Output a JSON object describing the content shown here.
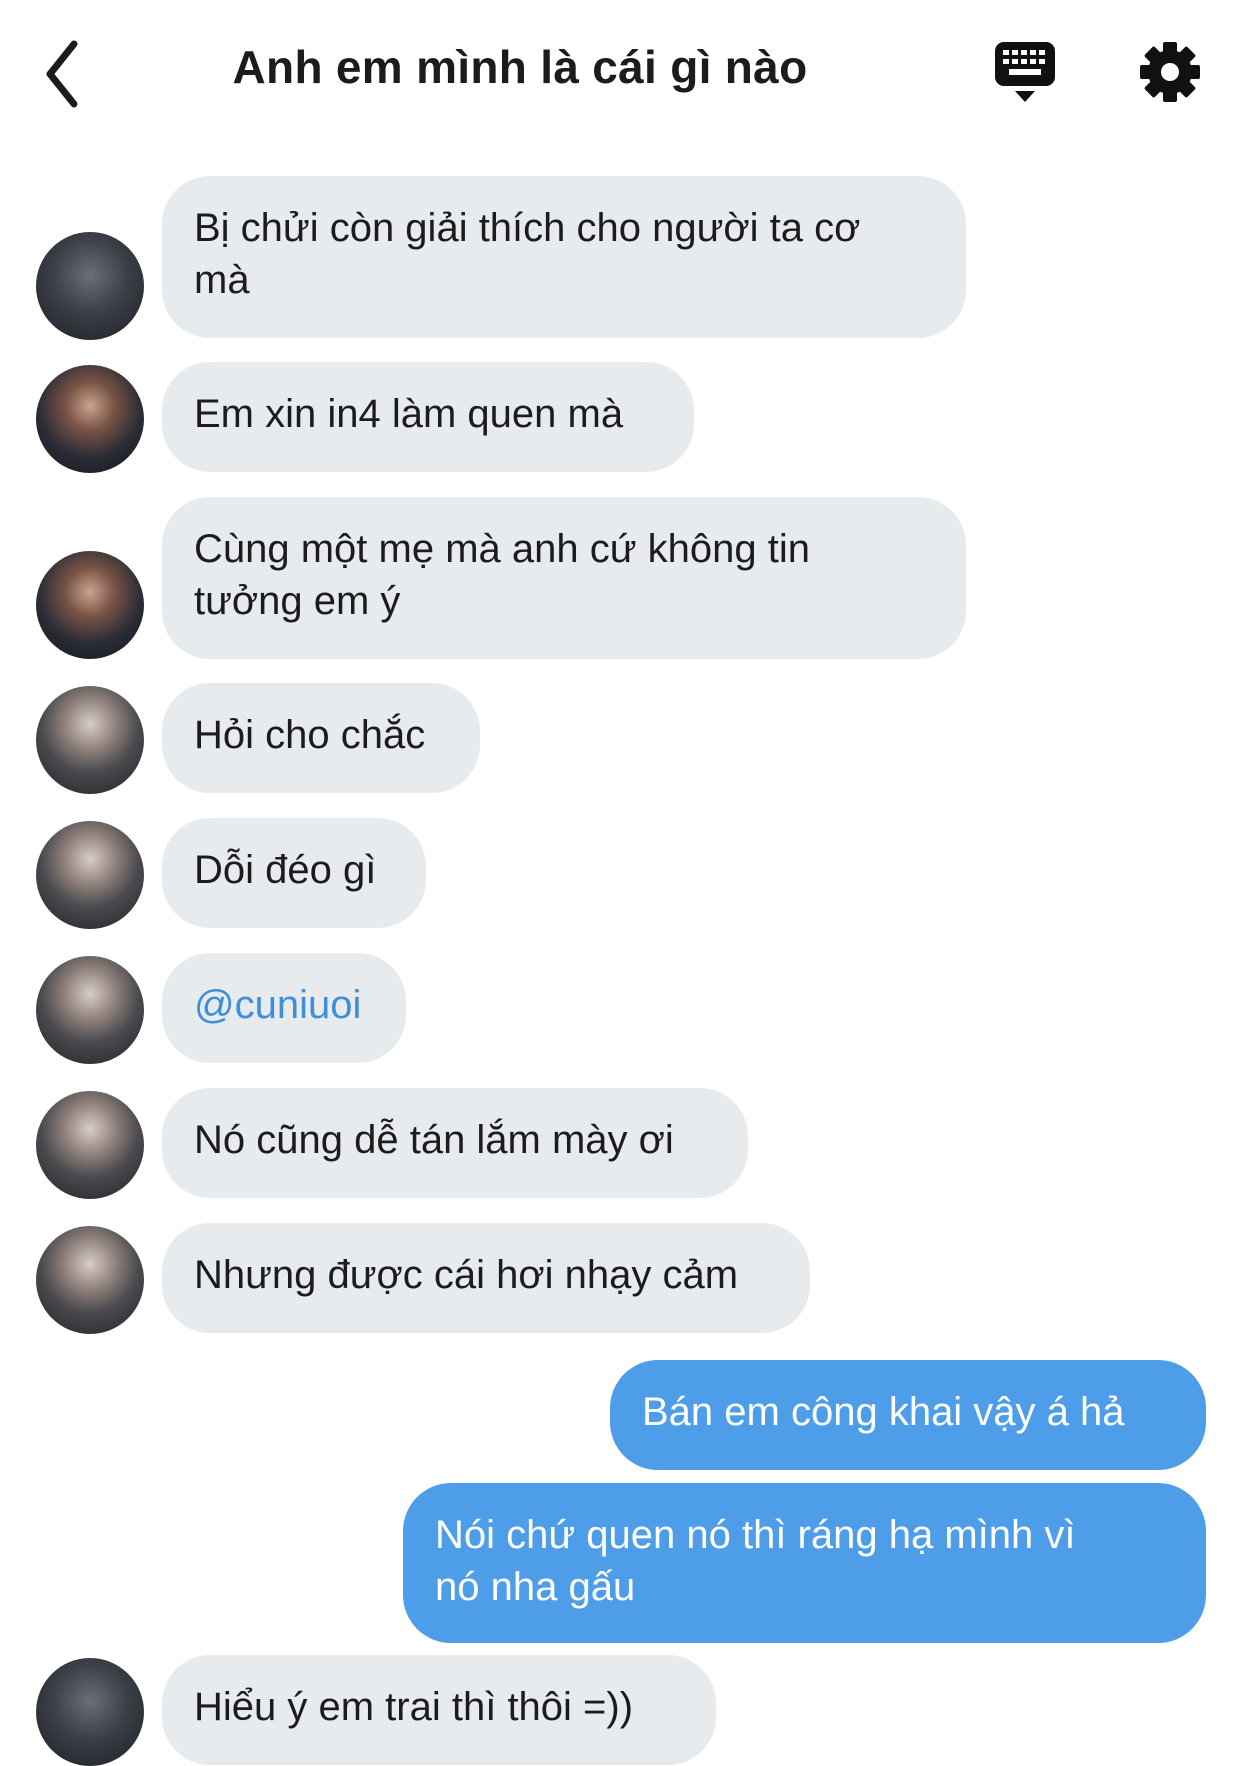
{
  "header": {
    "title": "Anh em mình là cái gì nào"
  },
  "messages": [
    {
      "side": "in",
      "text": "Bị chửi còn giải thích cho người ta cơ\nmà"
    },
    {
      "side": "in",
      "text": "Em xin in4 làm quen mà"
    },
    {
      "side": "in",
      "text": "Cùng một mẹ mà anh cứ không tin\ntưởng em ý"
    },
    {
      "side": "in",
      "text": "Hỏi cho chắc"
    },
    {
      "side": "in",
      "text": "Dỗi đéo gì"
    },
    {
      "side": "in",
      "text": "@cuniuoi"
    },
    {
      "side": "in",
      "text": "Nó cũng dễ tán lắm mày ơi"
    },
    {
      "side": "in",
      "text": "Nhưng được cái hơi nhạy cảm"
    },
    {
      "side": "out",
      "text": "Bán em công khai vậy á hả"
    },
    {
      "side": "out",
      "text": "Nói chứ quen nó thì ráng hạ mình vì\nnó nha gấu"
    },
    {
      "side": "in",
      "text": "Hiểu ý em trai thì thôi =))"
    }
  ],
  "colors": {
    "incoming_bubble": "#e8ebee",
    "outgoing_bubble": "#4d9de8",
    "mention": "#3d8fd9"
  },
  "icons": [
    "back-chevron-icon",
    "keyboard-icon",
    "gear-icon"
  ]
}
